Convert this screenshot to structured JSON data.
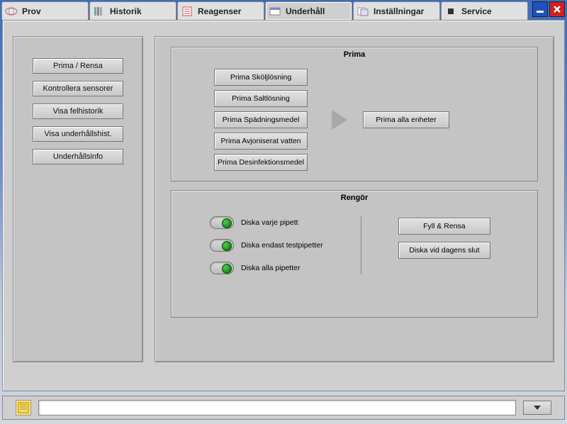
{
  "tabs": [
    {
      "label": "Prov",
      "active": false
    },
    {
      "label": "Historik",
      "active": false
    },
    {
      "label": "Reagenser",
      "active": false
    },
    {
      "label": "Underhåll",
      "active": true
    },
    {
      "label": "Inställningar",
      "active": false
    },
    {
      "label": "Service",
      "active": false
    }
  ],
  "sidebar": {
    "items": [
      {
        "label": "Prima / Rensa"
      },
      {
        "label": "Kontrollera sensorer"
      },
      {
        "label": "Visa felhistorik"
      },
      {
        "label": "Visa underhållshist."
      },
      {
        "label": "Underhållsinfo"
      }
    ]
  },
  "prima": {
    "title": "Prima",
    "buttons": [
      "Prima Sköljlösning",
      "Prima Saltlösning",
      "Prima Spädningsmedel",
      "Prima Avjoniserat vatten",
      "Prima Desinfektionsmedel"
    ],
    "all_label": "Prima alla enheter"
  },
  "rengor": {
    "title": "Rengör",
    "toggles": [
      "Diska varje pipett",
      "Diska endast testpipetter",
      "Diska alla pipetter"
    ],
    "right_buttons": [
      "Fyll & Rensa",
      "Diska vid dagens slut"
    ]
  },
  "status": {
    "value": ""
  }
}
